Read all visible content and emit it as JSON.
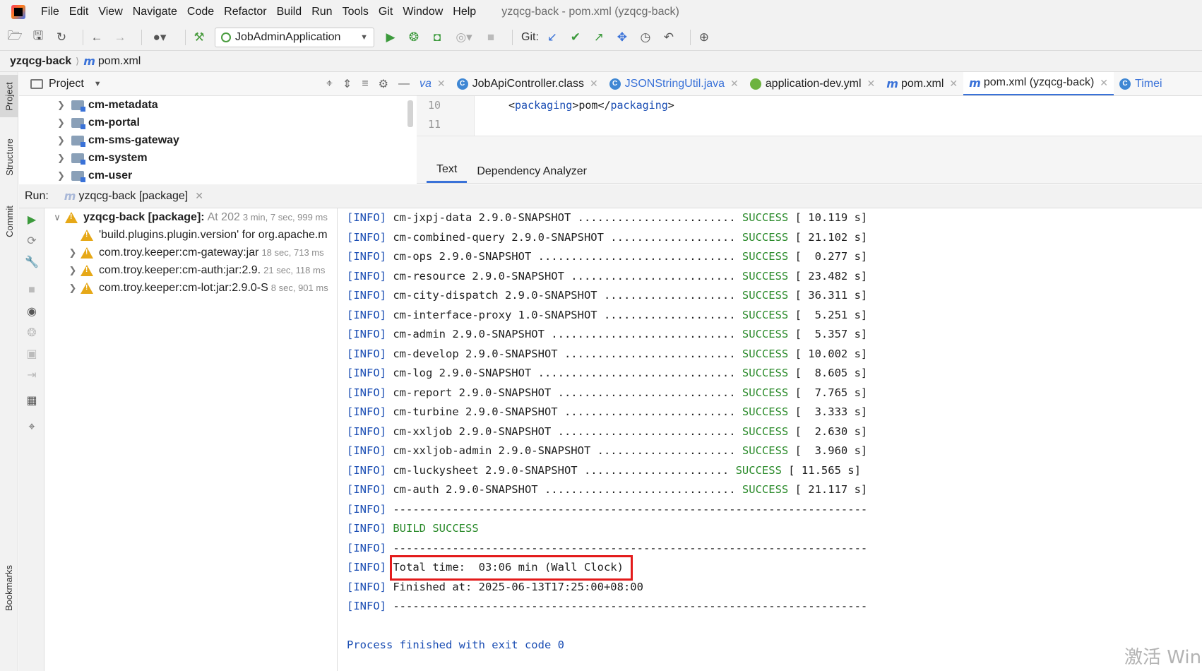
{
  "menubar": {
    "items": [
      "File",
      "Edit",
      "View",
      "Navigate",
      "Code",
      "Refactor",
      "Build",
      "Run",
      "Tools",
      "Git",
      "Window",
      "Help"
    ],
    "window_title": "yzqcg-back - pom.xml (yzqcg-back)"
  },
  "toolbar": {
    "run_config": "JobAdminApplication",
    "git_label": "Git:"
  },
  "breadcrumb": {
    "root": "yzqcg-back",
    "file": "pom.xml"
  },
  "left_strip": {
    "tabs": [
      "Project",
      "Structure",
      "Commit",
      "Bookmarks"
    ]
  },
  "project": {
    "title": "Project",
    "tree": [
      "cm-metadata",
      "cm-portal",
      "cm-sms-gateway",
      "cm-system",
      "cm-user"
    ]
  },
  "editor": {
    "tabs": [
      {
        "label": "va",
        "kind": "partial"
      },
      {
        "label": "JobApiController.class",
        "kind": "class"
      },
      {
        "label": "JSONStringUtil.java",
        "kind": "java"
      },
      {
        "label": "application-dev.yml",
        "kind": "yml"
      },
      {
        "label": "pom.xml",
        "kind": "maven"
      },
      {
        "label": "pom.xml (yzqcg-back)",
        "kind": "maven",
        "active": true
      },
      {
        "label": "Timei",
        "kind": "class"
      }
    ],
    "line_numbers": [
      "10",
      "11"
    ],
    "code": {
      "open_tag": "packaging",
      "value": "pom",
      "close_tag": "packaging"
    },
    "bottom_tabs": [
      "Text",
      "Dependency Analyzer"
    ]
  },
  "run": {
    "label": "Run:",
    "tab_title": "yzqcg-back [package]",
    "tree": {
      "root_title": "yzqcg-back [package]:",
      "root_status": "At 202",
      "root_time": "3 min, 7 sec, 999 ms",
      "items": [
        {
          "text": "'build.plugins.plugin.version' for org.apache.m",
          "time": ""
        },
        {
          "text": "com.troy.keeper:cm-gateway:jar",
          "time": "18 sec, 713 ms"
        },
        {
          "text": "com.troy.keeper:cm-auth:jar:2.9.",
          "time": "21 sec, 118 ms"
        },
        {
          "text": "com.troy.keeper:cm-lot:jar:2.9.0-S",
          "time": "8 sec, 901 ms"
        }
      ]
    }
  },
  "console": {
    "info_tag": "[INFO]",
    "modules": [
      {
        "name": "cm-jxpj-data 2.9.0-SNAPSHOT",
        "dots": "........................",
        "time": "10.119 s"
      },
      {
        "name": "cm-combined-query 2.9.0-SNAPSHOT",
        "dots": "...................",
        "time": "21.102 s"
      },
      {
        "name": "cm-ops 2.9.0-SNAPSHOT",
        "dots": "..............................",
        "time": " 0.277 s"
      },
      {
        "name": "cm-resource 2.9.0-SNAPSHOT",
        "dots": ".........................",
        "time": "23.482 s"
      },
      {
        "name": "cm-city-dispatch 2.9.0-SNAPSHOT",
        "dots": "....................",
        "time": "36.311 s"
      },
      {
        "name": "cm-interface-proxy 1.0-SNAPSHOT",
        "dots": "....................",
        "time": " 5.251 s"
      },
      {
        "name": "cm-admin 2.9.0-SNAPSHOT",
        "dots": "............................",
        "time": " 5.357 s"
      },
      {
        "name": "cm-develop 2.9.0-SNAPSHOT",
        "dots": "..........................",
        "time": "10.002 s"
      },
      {
        "name": "cm-log 2.9.0-SNAPSHOT",
        "dots": "..............................",
        "time": " 8.605 s"
      },
      {
        "name": "cm-report 2.9.0-SNAPSHOT",
        "dots": "...........................",
        "time": " 7.765 s"
      },
      {
        "name": "cm-turbine 2.9.0-SNAPSHOT",
        "dots": "..........................",
        "time": " 3.333 s"
      },
      {
        "name": "cm-xxljob 2.9.0-SNAPSHOT",
        "dots": "...........................",
        "time": " 2.630 s"
      },
      {
        "name": "cm-xxljob-admin 2.9.0-SNAPSHOT",
        "dots": ".....................",
        "time": " 3.960 s"
      },
      {
        "name": "cm-luckysheet 2.9.0-SNAPSHOT",
        "dots": "......................",
        "time": "11.565 s"
      },
      {
        "name": "cm-auth 2.9.0-SNAPSHOT",
        "dots": ".............................",
        "time": "21.117 s"
      }
    ],
    "success_word": "SUCCESS",
    "separator": "------------------------------------------------------------------------",
    "build_success": "BUILD SUCCESS",
    "total_time": "Total time:  03:06 min (Wall Clock)",
    "finished_at": "Finished at: 2025-06-13T17:25:00+08:00",
    "process_finished": "Process finished with exit code 0"
  },
  "watermark": "激活 Windows",
  "colors": {
    "accent": "#3a72d8",
    "info": "#1a4db3",
    "success": "#2a8a2a",
    "highlight_box": "#e31b1b",
    "warning": "#e6a817"
  }
}
